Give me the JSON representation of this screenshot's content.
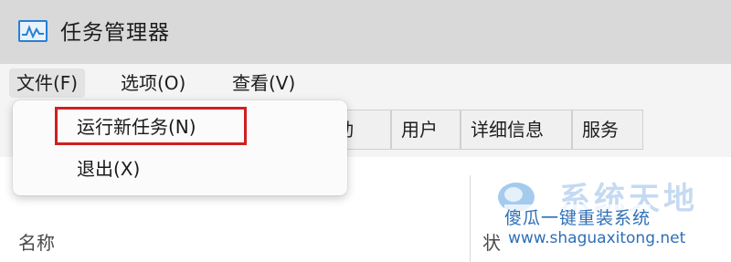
{
  "window": {
    "title": "任务管理器"
  },
  "menubar": {
    "items": [
      {
        "label": "文件(F)"
      },
      {
        "label": "选项(O)"
      },
      {
        "label": "查看(V)"
      }
    ]
  },
  "file_menu": {
    "items": [
      {
        "label": "运行新任务(N)",
        "highlighted": true
      },
      {
        "label": "退出(X)"
      }
    ]
  },
  "tabs": [
    {
      "label": "启动",
      "visible_part": "动"
    },
    {
      "label": "用户"
    },
    {
      "label": "详细信息"
    },
    {
      "label": "服务"
    }
  ],
  "table": {
    "columns": [
      "名称"
    ],
    "right_column_partial": "状"
  },
  "watermark": {
    "brand": "系统天地",
    "line1": "傻瓜一键重装系统",
    "line2": "www.shaguaxitong.net"
  },
  "colors": {
    "highlight_border": "#cf2020",
    "titlebar_bg": "#d9d9d9",
    "menubar_bg": "#f4f4f4",
    "watermark_blue": "#2e6fb8"
  },
  "icons": {
    "app": "task-manager-icon",
    "watermark_logo": "watermark-logo-icon"
  }
}
